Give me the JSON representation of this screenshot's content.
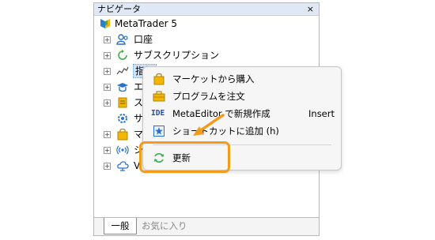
{
  "navigator": {
    "title": "ナビゲータ",
    "close": "×",
    "root": "MetaTrader 5",
    "items": [
      {
        "label": "口座",
        "icon": "accounts-icon"
      },
      {
        "label": "サブスクリプション",
        "icon": "subscription-icon"
      },
      {
        "label": "指標",
        "icon": "indicator-icon"
      },
      {
        "label": "エ",
        "icon": "expert-icon"
      },
      {
        "label": "ス",
        "icon": "script-icon"
      },
      {
        "label": "サ",
        "icon": "service-icon"
      },
      {
        "label": "マ",
        "icon": "market-icon"
      },
      {
        "label": "シ",
        "icon": "signal-icon"
      },
      {
        "label": "V",
        "icon": "vps-icon"
      }
    ],
    "tabs": {
      "active": "一般",
      "inactive": "お気に入り"
    }
  },
  "context_menu": {
    "items": [
      {
        "label": "マーケットから購入",
        "icon": "shopping-bag-icon",
        "shortcut": ""
      },
      {
        "label": "プログラムを注文",
        "icon": "briefcase-icon",
        "shortcut": ""
      },
      {
        "label": "MetaEditor で新規作成",
        "icon": "ide-icon",
        "icon_text": "IDE",
        "shortcut": "Insert"
      },
      {
        "label": "ショートカットに追加 (h)",
        "icon": "shortcut-star-icon",
        "shortcut": ""
      },
      {
        "label": "更新",
        "icon": "refresh-icon",
        "shortcut": ""
      }
    ]
  },
  "colors": {
    "highlight": "#f39b1b",
    "selection": "#cfe3f7"
  }
}
